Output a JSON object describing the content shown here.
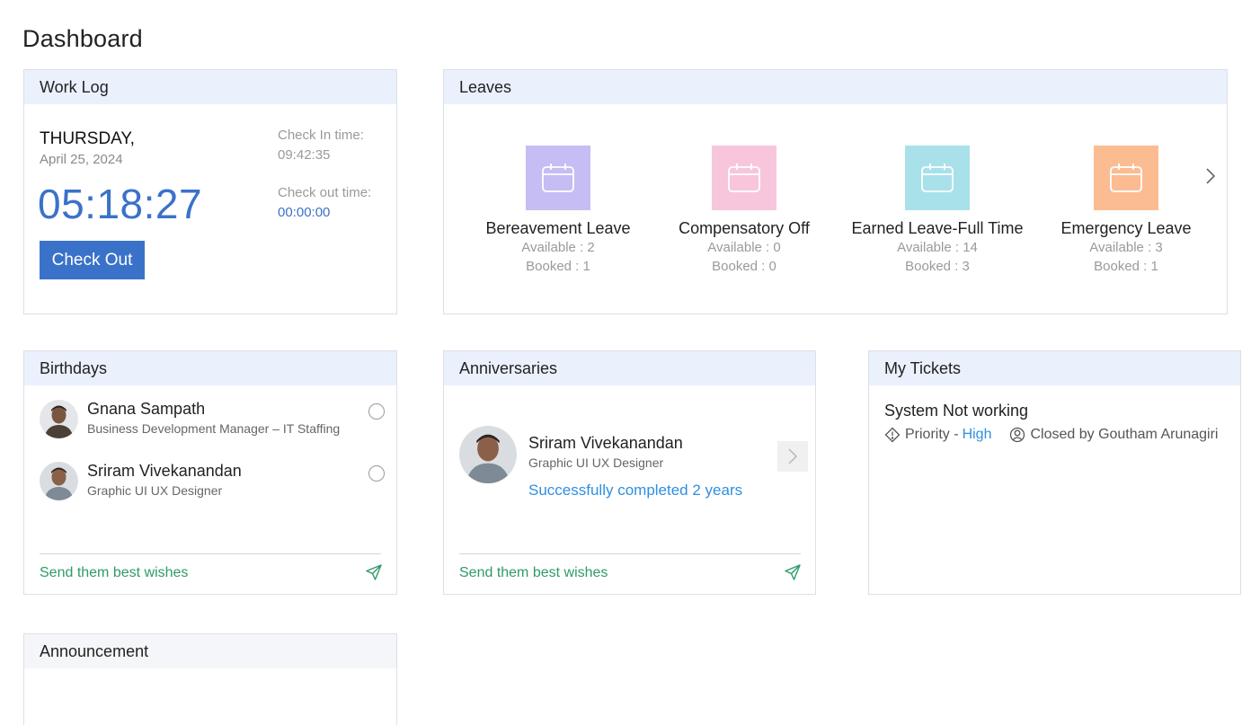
{
  "page": {
    "title": "Dashboard"
  },
  "worklog": {
    "header": "Work Log",
    "day": "THURSDAY,",
    "date": "April 25, 2024",
    "clock": "05:18:27",
    "button_label": "Check Out",
    "checkin_label": "Check In time:",
    "checkin_value": "09:42:35",
    "checkout_label": "Check out time:",
    "checkout_value": "00:00:00"
  },
  "leaves": {
    "header": "Leaves",
    "items": [
      {
        "name": "Bereavement Leave",
        "available": "Available : 2",
        "booked": "Booked : 1",
        "color": "#c5bdf3"
      },
      {
        "name": "Compensatory Off",
        "available": "Available : 0",
        "booked": "Booked : 0",
        "color": "#f7c6dd"
      },
      {
        "name": "Earned Leave-Full Time",
        "available": "Available : 14",
        "booked": "Booked : 3",
        "color": "#a8e1ea"
      },
      {
        "name": "Emergency Leave",
        "available": "Available : 3",
        "booked": "Booked : 1",
        "color": "#fcbc92"
      }
    ]
  },
  "birthdays": {
    "header": "Birthdays",
    "people": [
      {
        "name": "Gnana Sampath",
        "role": "Business Development Manager – IT Staffing"
      },
      {
        "name": "Sriram Vivekanandan",
        "role": "Graphic UI UX Designer"
      }
    ],
    "wish_label": "Send them best wishes"
  },
  "anniversaries": {
    "header": "Anniversaries",
    "name": "Sriram Vivekanandan",
    "role": "Graphic UI UX Designer",
    "message": "Successfully completed 2 years",
    "wish_label": "Send them best wishes"
  },
  "tickets": {
    "header": "My Tickets",
    "title": "System Not working",
    "priority_label": "Priority -",
    "priority_value": "High",
    "closed_by": "Closed by Goutham Arunagiri"
  },
  "announcement": {
    "header": "Announcement"
  },
  "colors": {
    "accent": "#3a72c9",
    "link": "#2f8fe0",
    "wish": "#2f9a6a",
    "header_bg": "#eaf1fd"
  }
}
